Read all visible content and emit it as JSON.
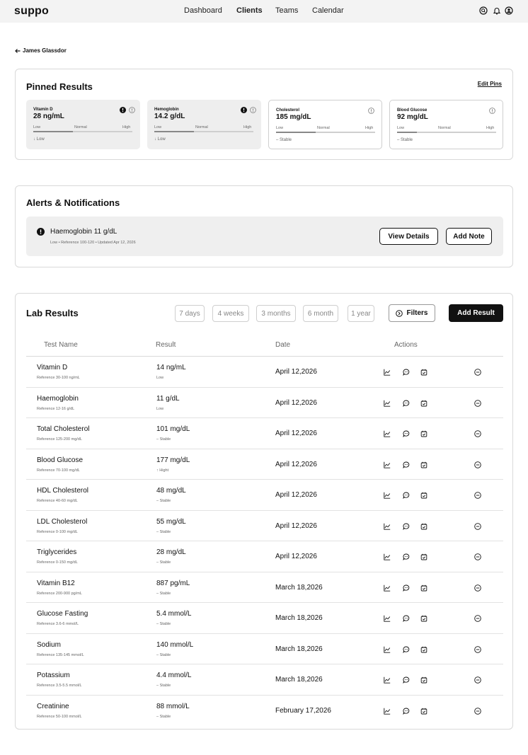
{
  "app": {
    "logo": "suppo"
  },
  "nav": {
    "items": [
      "Dashboard",
      "Clients",
      "Teams",
      "Calendar"
    ],
    "active": "Clients"
  },
  "header_icons": [
    "search-icon",
    "bell-icon",
    "user-icon"
  ],
  "breadcrumb": {
    "back_label": "James Glassdor"
  },
  "pinned": {
    "title": "Pinned Results",
    "edit_label": "Edit Pins",
    "cards": [
      {
        "name": "Vitamin D",
        "value": "28 ng/mL",
        "low": "Low",
        "normal": "Normal",
        "high": "High",
        "trend": "↓ Low",
        "level": 0.4,
        "alert": true
      },
      {
        "name": "Hemoglobin",
        "value": "14.2 g/dL",
        "low": "Low",
        "normal": "Normal",
        "high": "High",
        "trend": "↓ Low",
        "level": 0.4,
        "alert": true
      },
      {
        "name": "Cholesterol",
        "value": "185 mg/dL",
        "low": "Low",
        "normal": "Normal",
        "high": "High",
        "trend": "– Stable",
        "level": 0.4,
        "alert": false
      },
      {
        "name": "Blood Glucose",
        "value": "92 mg/dL",
        "low": "Low",
        "normal": "Normal",
        "high": "High",
        "trend": "– Stable",
        "level": 0.2,
        "alert": false
      }
    ]
  },
  "alerts": {
    "title": "Alerts & Notifications",
    "item": {
      "title": "Haemoglobin 11 g/dL",
      "subtitle": "Low • Reference 100-120 • Updated Apr 12, 2026",
      "view_label": "View Details",
      "note_label": "Add Note"
    }
  },
  "lab": {
    "title": "Lab Results",
    "ranges": [
      "7 days",
      "4 weeks",
      "3 months",
      "6 month",
      "1 year"
    ],
    "filters_label": "Filters",
    "add_label": "Add Result",
    "columns": [
      "Test Name",
      "Result",
      "Date",
      "Actions"
    ],
    "rows": [
      {
        "name": "Vitamin D",
        "ref": "Reference 30-100 ng/mL",
        "value": "14 ng/mL",
        "trend": "Low",
        "date": "April 12,2026"
      },
      {
        "name": "Haemoglobin",
        "ref": "Reference 12-16 g/dL",
        "value": "11 g/dL",
        "trend": "Low",
        "date": "April 12,2026"
      },
      {
        "name": "Total Cholesterol",
        "ref": "Reference 125-200 mg/dL",
        "value": "101 mg/dL",
        "trend": "– Stable",
        "date": "April 12,2026"
      },
      {
        "name": "Blood Glucose",
        "ref": "Reference 70-100 mg/dL",
        "value": "177 mg/dL",
        "trend": "↑ Hight",
        "date": "April 12,2026"
      },
      {
        "name": "HDL Cholesterol",
        "ref": "Reference 40-60 mg/dL",
        "value": "48 mg/dL",
        "trend": "– Stable",
        "date": "April 12,2026"
      },
      {
        "name": "LDL Cholesterol",
        "ref": "Reference 0-100 mg/dL",
        "value": "55 mg/dL",
        "trend": "– Stable",
        "date": "April 12,2026"
      },
      {
        "name": "Triglycerides",
        "ref": "Reference 0-150 mg/dL",
        "value": "28 mg/dL",
        "trend": "– Stable",
        "date": "April 12,2026"
      },
      {
        "name": "Vitamin B12",
        "ref": "Reference 200-900 pg/mL",
        "value": "887 pg/mL",
        "trend": "– Stable",
        "date": "March 18,2026"
      },
      {
        "name": "Glucose Fasting",
        "ref": "Reference 3.6-6 mmol/L",
        "value": "5.4 mmol/L",
        "trend": "– Stable",
        "date": "March 18,2026"
      },
      {
        "name": "Sodium",
        "ref": "Reference 135-145 mmol/L",
        "value": "140 mmol/L",
        "trend": "– Stable",
        "date": "March 18,2026"
      },
      {
        "name": "Potassium",
        "ref": "Reference 3.5-5.5 mmol/L",
        "value": "4.4 mmol/L",
        "trend": "– Stable",
        "date": "March 18,2026"
      },
      {
        "name": "Creatinine",
        "ref": "Reference 50-100 mmol/L",
        "value": "88 mmol/L",
        "trend": "– Stable",
        "date": "February 17,2026"
      }
    ],
    "row_action_icons": [
      "chart-icon",
      "comment-icon",
      "calendar-icon",
      "remove-icon"
    ]
  }
}
